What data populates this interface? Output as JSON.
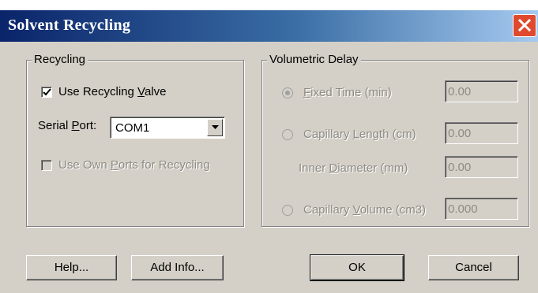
{
  "window": {
    "title": "Solvent Recycling"
  },
  "recycling": {
    "legend": "Recycling",
    "use_recycling_valve_pre": "Use Recycling ",
    "use_recycling_valve_mnemonic": "V",
    "use_recycling_valve_post": "alve",
    "use_recycling_valve_checked": true,
    "serial_port_pre": "Serial ",
    "serial_port_mnemonic": "P",
    "serial_port_post": "ort:",
    "serial_port_value": "COM1",
    "use_own_ports_pre": "Use Own ",
    "use_own_ports_mnemonic": "P",
    "use_own_ports_post": "orts for Recycling",
    "use_own_ports_checked": false
  },
  "volumetric_delay": {
    "legend": "Volumetric Delay",
    "fixed_time_mnemonic": "F",
    "fixed_time_post": "ixed Time (min)",
    "fixed_time_value": "0.00",
    "capillary_length_pre": "Capillary ",
    "capillary_length_mnemonic": "L",
    "capillary_length_post": "ength (cm)",
    "capillary_length_value": "0.00",
    "inner_diameter_pre": "Inner ",
    "inner_diameter_mnemonic": "D",
    "inner_diameter_post": "iameter (mm)",
    "inner_diameter_value": "0.00",
    "capillary_volume_pre": "Capillary ",
    "capillary_volume_mnemonic": "V",
    "capillary_volume_post": "olume (cm3)",
    "capillary_volume_value": "0.000",
    "selected_option": "fixed_time"
  },
  "buttons": {
    "help": "Help...",
    "add_info": "Add Info...",
    "ok": "OK",
    "cancel": "Cancel"
  },
  "colors": {
    "dialog_face": "#d4d0c8",
    "close_button": "#e0492e",
    "disabled_text": "#8e8b83"
  }
}
